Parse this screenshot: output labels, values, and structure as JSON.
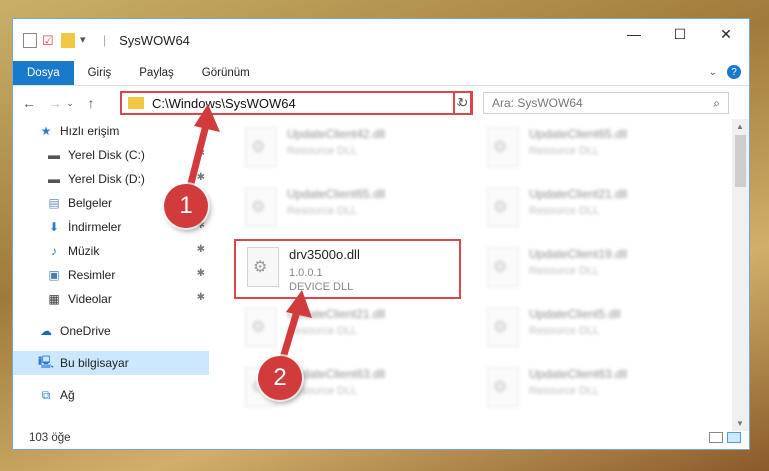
{
  "window": {
    "title": "SysWOW64",
    "buttons": {
      "minimize": "—",
      "maximize": "☐",
      "close": "✕"
    }
  },
  "ribbon": {
    "tabs": [
      "Dosya",
      "Giriş",
      "Paylaş",
      "Görünüm"
    ]
  },
  "navigation": {
    "address": "C:\\Windows\\SysWOW64",
    "search_placeholder": "Ara: SysWOW64"
  },
  "sidebar": {
    "items": [
      {
        "label": "Hızlı erişim",
        "icon": "star-icon"
      },
      {
        "label": "Yerel Disk (C:)",
        "icon": "drive-icon"
      },
      {
        "label": "Yerel Disk (D:)",
        "icon": "drive-icon"
      },
      {
        "label": "Belgeler",
        "icon": "documents-icon"
      },
      {
        "label": "İndirmeler",
        "icon": "download-icon"
      },
      {
        "label": "Müzik",
        "icon": "music-icon"
      },
      {
        "label": "Resimler",
        "icon": "pictures-icon"
      },
      {
        "label": "Videolar",
        "icon": "video-icon"
      },
      {
        "label": "OneDrive",
        "icon": "cloud-icon"
      },
      {
        "label": "Bu bilgisayar",
        "icon": "computer-icon"
      },
      {
        "label": "Ağ",
        "icon": "network-icon"
      }
    ]
  },
  "files": [
    {
      "name": "UpdateClient42.dll",
      "type": "Resource DLL"
    },
    {
      "name": "UpdateClient65.dll",
      "type": "Resource DLL"
    },
    {
      "name": "UpdateClient65.dll",
      "type": "Resource DLL"
    },
    {
      "name": "UpdateClient21.dll",
      "type": "Resource DLL"
    },
    {
      "name": "drv3500o.dll",
      "version": "1.0.0.1",
      "type": "DEVICE DLL"
    },
    {
      "name": "UpdateClient19.dll",
      "type": "Resource DLL"
    },
    {
      "name": "UpdateClient21.dll",
      "type": "Resource DLL"
    },
    {
      "name": "UpdateClient5.dll",
      "type": "Resource DLL"
    },
    {
      "name": "UpdateClient63.dll",
      "type": "Resource DLL"
    },
    {
      "name": "UpdateClient63.dll",
      "type": "Resource DLL"
    }
  ],
  "status": {
    "count": "103 öğe"
  },
  "annotations": {
    "step1": "1",
    "step2": "2",
    "color": "#d23b3b"
  }
}
